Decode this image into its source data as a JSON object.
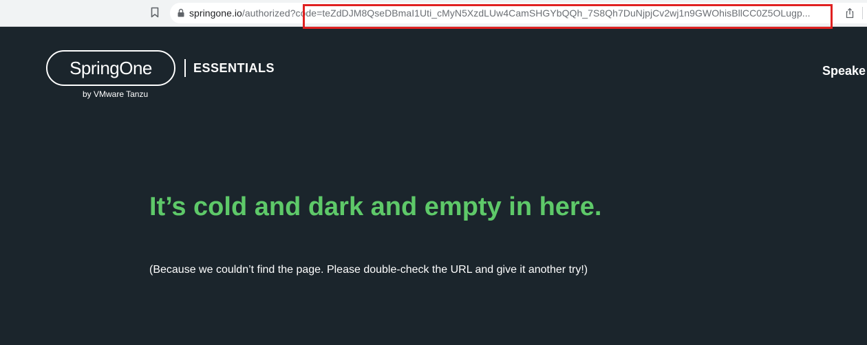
{
  "browser": {
    "url_host": "springone.io",
    "url_path": "/authorized?code=teZdDJM8QseDBmaI1Uti_cMyN5XzdLUw4CamSHGYbQQh_7S8Qh7DuNjpjCv2wj1n9GWOhisBllCC0Z5OLugp...",
    "icons": {
      "bookmark": "bookmark-icon",
      "lock": "lock-icon",
      "share": "share-icon"
    },
    "highlight_color": "#e02020"
  },
  "header": {
    "logo": "SpringOne",
    "logo_sub": "by VMware Tanzu",
    "section": "ESSENTIALS",
    "nav_item": "Speake"
  },
  "main": {
    "headline": "It’s cold and dark and empty in here.",
    "subtext": "(Because we couldn’t find the page. Please double-check the URL and give it another try!)"
  },
  "colors": {
    "background": "#1b252c",
    "headline": "#5ec969",
    "text": "#ffffff"
  }
}
